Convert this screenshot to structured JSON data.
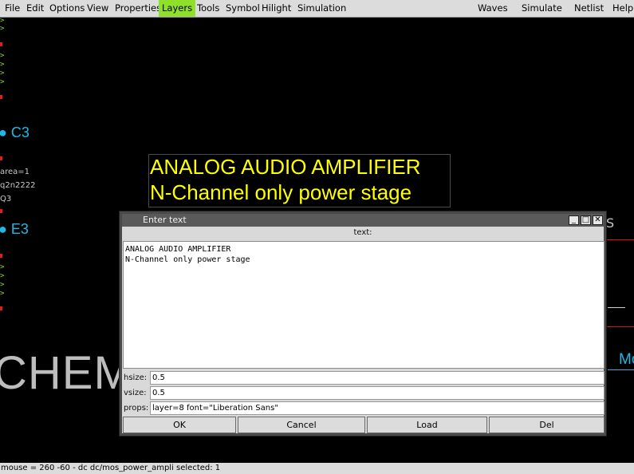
{
  "menu": {
    "left": [
      "File",
      "Edit",
      "Options",
      "View",
      "Properties",
      "Layers",
      "Tools",
      "Symbol",
      "Hilight",
      "Simulation"
    ],
    "right": [
      "Waves",
      "Simulate",
      "Netlist",
      "Help"
    ],
    "active": "Layers"
  },
  "canvas": {
    "pin_glyph": ">",
    "labels": {
      "c3": "C3",
      "e3": "E3",
      "area": "area=1",
      "model": "q2n2222",
      "name": "Q3",
      "xschem": "CHEM",
      "right_s": "S",
      "mo": "Mo"
    },
    "text_object": {
      "line1": "ANALOG AUDIO AMPLIFIER",
      "line2": "N-Channel only power stage"
    }
  },
  "dialog": {
    "title": "Enter text",
    "text_label": "text:",
    "text_value": "ANALOG AUDIO AMPLIFIER\nN-Channel only power stage",
    "hsize_label": "hsize:",
    "hsize_value": "0.5",
    "vsize_label": "vsize:",
    "vsize_value": "0.5",
    "props_label": "props:",
    "props_value": "layer=8 font=\"Liberation Sans\"",
    "buttons": {
      "ok": "OK",
      "cancel": "Cancel",
      "load": "Load",
      "del": "Del"
    },
    "titlebar_icons": [
      "minimize-icon",
      "maximize-icon",
      "close-icon"
    ]
  },
  "status": {
    "text": "mouse = 260 -60 - dc  dc/mos_power_ampli  selected: 1"
  },
  "colors": {
    "accent_menu": "#8fe02a",
    "canvas_bg": "#000000",
    "text_object": "#ffff00",
    "net_label": "#1fb8e6",
    "pin_marker": "#e01c1c"
  }
}
